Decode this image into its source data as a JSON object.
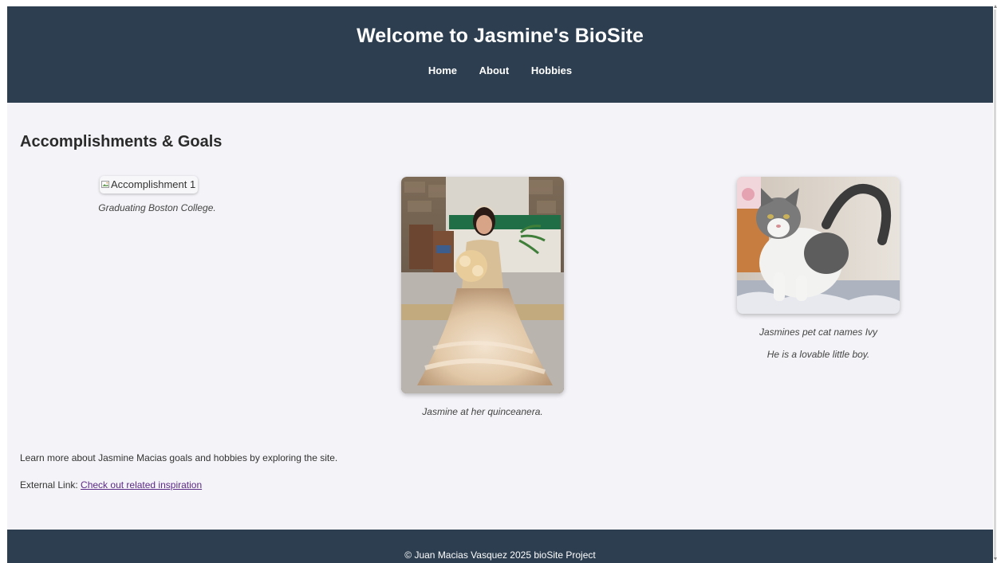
{
  "header": {
    "title": "Welcome to Jasmine's BioSite",
    "nav": [
      "Home",
      "About",
      "Hobbies"
    ]
  },
  "main": {
    "heading": "Accomplishments & Goals",
    "items": [
      {
        "alt": "Accomplishment 1",
        "caption": "Graduating Boston College."
      },
      {
        "caption": "Jasmine at her quinceanera."
      },
      {
        "caption_line1": "Jasmines pet cat names Ivy",
        "caption_line2": "He is a lovable little boy."
      }
    ],
    "intro": "Learn more about Jasmine Macias goals and hobbies by exploring the site.",
    "external_prefix": "External Link: ",
    "external_link_text": "Check out related inspiration"
  },
  "footer": {
    "copyright": "© Juan Macias Vasquez 2025 bioSite Project"
  },
  "colors": {
    "header_bg": "#2c3e50",
    "page_bg": "#f4f4f8",
    "link_visited": "#5b2a86"
  }
}
